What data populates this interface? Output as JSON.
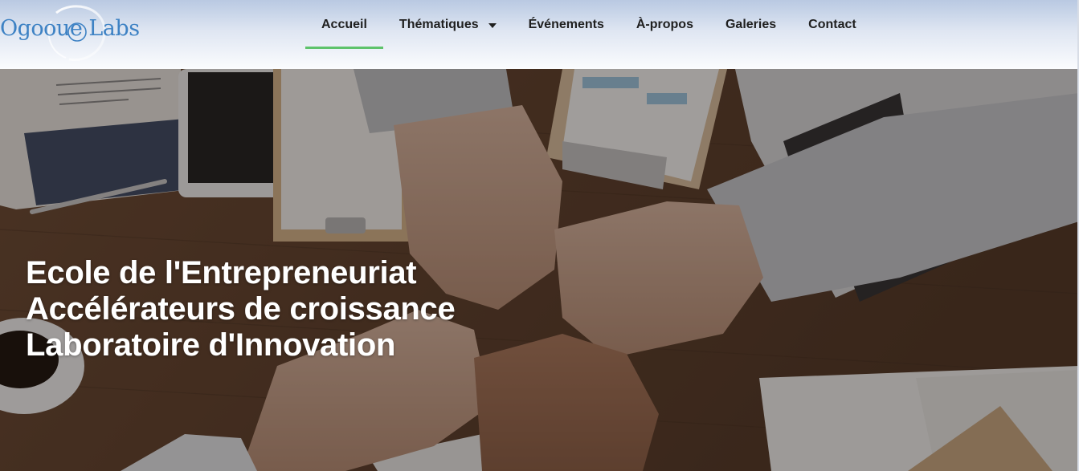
{
  "brand": {
    "logo_text": "Ogooue Labs",
    "accent_color": "#3e82c4"
  },
  "nav": {
    "items": [
      {
        "label": "Accueil",
        "active": true
      },
      {
        "label": "Thématiques",
        "has_dropdown": true
      },
      {
        "label": "Événements"
      },
      {
        "label": "À-propos"
      },
      {
        "label": "Galeries"
      },
      {
        "label": "Contact"
      }
    ],
    "active_indicator_color": "#5ec36b"
  },
  "hero": {
    "lines": [
      "Ecole de l'Entrepreneuriat",
      "Accélérateurs de croissance",
      "Laboratoire d'Innovation"
    ],
    "background_image": "team fist-bump over wooden desk with documents, tablet and laptop",
    "text_color": "#ffffff"
  }
}
